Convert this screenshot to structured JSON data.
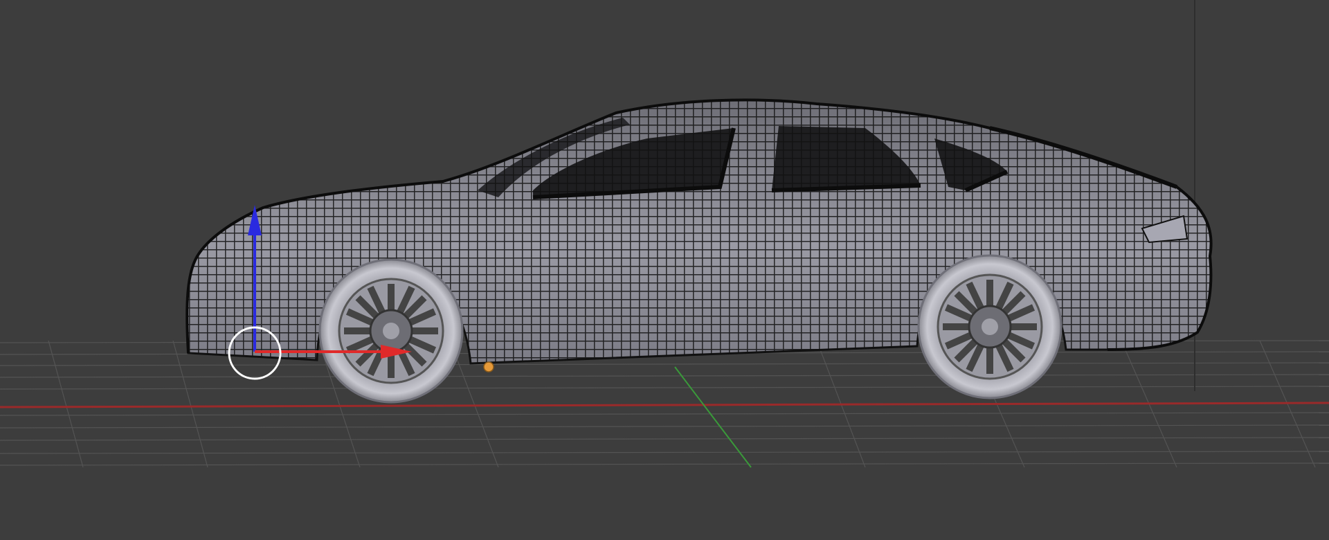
{
  "viewport": {
    "background": "#3d3d3d",
    "grid_line_color": "#555555",
    "x_axis_color": "#9a2a2a",
    "y_axis_color": "#3a9a3a"
  },
  "object": {
    "type": "car-mesh",
    "mode": "edit-mode-wireframe",
    "body_color": "#8e8e96",
    "wire_color": "#101010",
    "glass_color": "#202022",
    "tire_color": "#b9b9c1",
    "rim_color": "#7c7c82"
  },
  "gizmo": {
    "z_axis_color": "#2a2ae0",
    "x_axis_color": "#e02a2a",
    "ring_color": "#ffffff"
  },
  "origin": {
    "color": "#e69a3a"
  }
}
